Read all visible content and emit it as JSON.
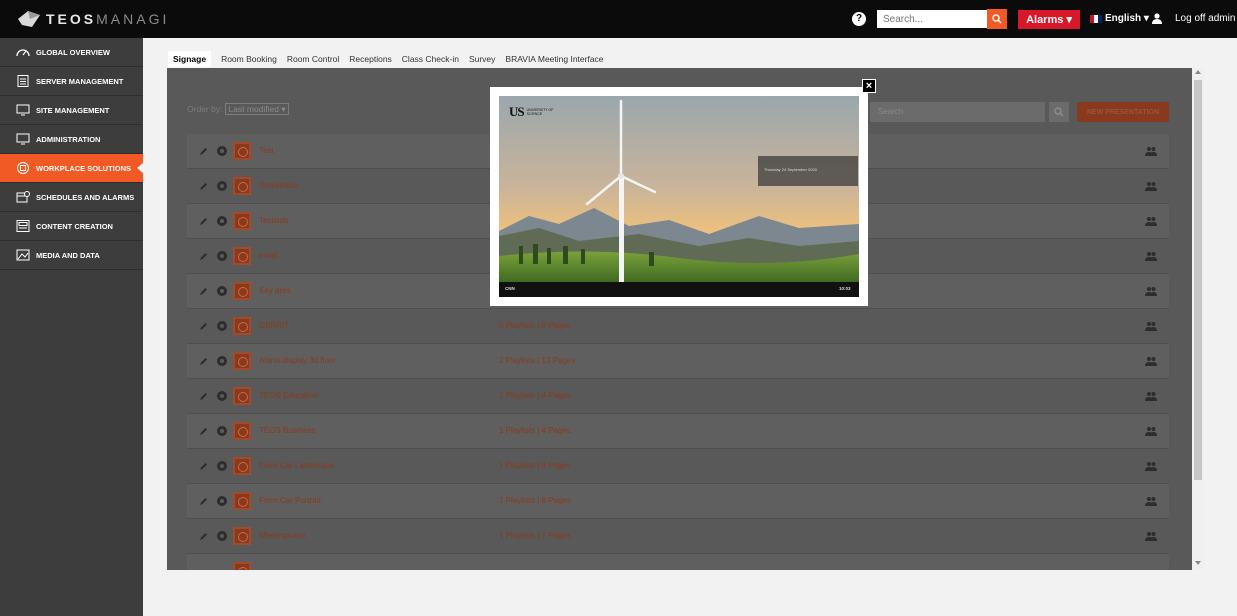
{
  "brand": {
    "name_strong": "TEOS",
    "name_dim": "MANAGI"
  },
  "topbar": {
    "help_glyph": "?",
    "search_placeholder": "Search...",
    "alarms_label": "Alarms ▾",
    "language_label": "English ▾",
    "logoff_label": "Log off admin"
  },
  "sidebar": {
    "items": [
      {
        "label": "GLOBAL OVERVIEW",
        "icon": "gauge-icon",
        "active": false
      },
      {
        "label": "SERVER MANAGEMENT",
        "icon": "server-icon",
        "active": false
      },
      {
        "label": "SITE MANAGEMENT",
        "icon": "monitor-icon",
        "active": false
      },
      {
        "label": "ADMINISTRATION",
        "icon": "monitor-icon",
        "active": false
      },
      {
        "label": "WORKPLACE SOLUTIONS",
        "icon": "grid-icon",
        "active": true
      },
      {
        "label": "SCHEDULES AND ALARMS",
        "icon": "calendar-icon",
        "active": false
      },
      {
        "label": "CONTENT CREATION",
        "icon": "layout-icon",
        "active": false
      },
      {
        "label": "MEDIA AND DATA",
        "icon": "image-icon",
        "active": false
      }
    ]
  },
  "tabs": [
    {
      "label": "Signage",
      "active": true
    },
    {
      "label": "Room Booking",
      "active": false
    },
    {
      "label": "Room Control",
      "active": false
    },
    {
      "label": "Receptions",
      "active": false
    },
    {
      "label": "Class Check-in",
      "active": false
    },
    {
      "label": "Survey",
      "active": false
    },
    {
      "label": "BRAVIA Meeting Interface",
      "active": false
    }
  ],
  "toolbar": {
    "order_label": "Order by:",
    "order_value": "Last modified ▾",
    "search_placeholder": "Search",
    "new_presentation_label": "NEW PRESENTATION"
  },
  "presentations": [
    {
      "name": "Test",
      "meta": ""
    },
    {
      "name": "Testwillsbiz",
      "meta": ""
    },
    {
      "name": "Testweb",
      "meta": ""
    },
    {
      "name": "email",
      "meta": ""
    },
    {
      "name": "Key pres",
      "meta": ""
    },
    {
      "name": "GERRIT",
      "meta": "0 Playlists | 0 Pages"
    },
    {
      "name": "Alarm display 3d floor",
      "meta": "2 Playlists | 13 Pages"
    },
    {
      "name": "TEOS Education",
      "meta": "1 Playlists | 4 Pages"
    },
    {
      "name": "TEOS Business",
      "meta": "1 Playlists | 4 Pages"
    },
    {
      "name": "Form Car Landscape",
      "meta": "1 Playlists | 9 Pages"
    },
    {
      "name": "Form Car Portrait",
      "meta": "1 Playlists | 8 Pages"
    },
    {
      "name": "Meetingroom",
      "meta": "1 Playlists | 7 Pages"
    }
  ],
  "modal": {
    "close_glyph": "×",
    "logo_big": "US",
    "logo_small": "UNIVERSITY OF SCIENCE",
    "date_text": "Thursday 24 September 2020",
    "footer_left": "CNN",
    "footer_right": "10:03"
  },
  "colors": {
    "accent": "#f15a24",
    "alarm": "#d7182a",
    "sidebar": "#3d3d3d",
    "topbar": "#0b0b0b"
  }
}
